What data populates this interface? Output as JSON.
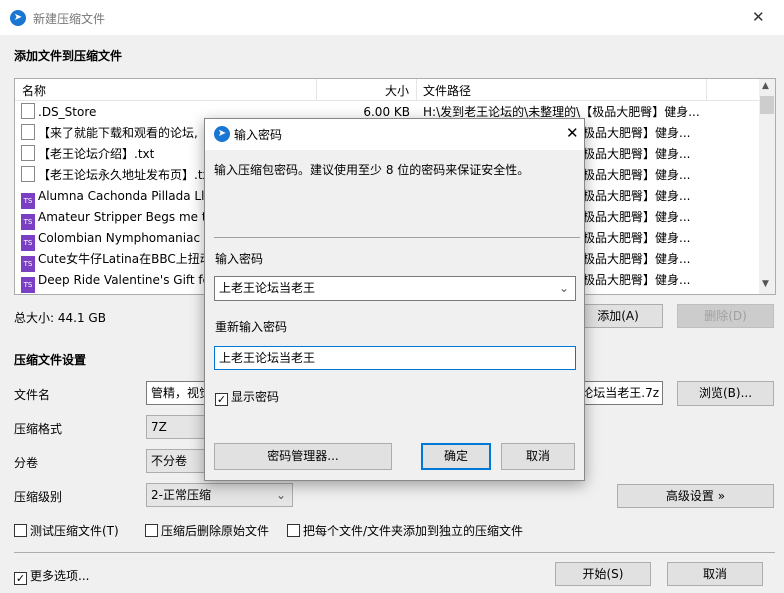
{
  "window": {
    "title": "新建压缩文件",
    "close": "✕"
  },
  "section_add": "添加文件到压缩文件",
  "list": {
    "headers": {
      "name": "名称",
      "size": "大小",
      "path": "文件路径"
    },
    "rows": [
      {
        "icon": "doc",
        "name": ".DS_Store",
        "size": "6.00 KB",
        "path": "H:\\发到老王论坛的\\未整理的\\【极品大肥臀】健身..."
      },
      {
        "icon": "doc",
        "name": "【来了就能下载和观看的论坛,",
        "size": "",
        "path": "【极品大肥臀】健身..."
      },
      {
        "icon": "doc",
        "name": "【老王论坛介绍】.txt",
        "size": "",
        "path": "【极品大肥臀】健身..."
      },
      {
        "icon": "doc",
        "name": "【老王论坛永久地址发布页】.txt",
        "size": "",
        "path": "【极品大肥臀】健身..."
      },
      {
        "icon": "ts",
        "name": "Alumna Cachonda Pillada Lle",
        "size": "",
        "path": "【极品大肥臀】健身..."
      },
      {
        "icon": "ts",
        "name": "Amateur Stripper Begs me to",
        "size": "",
        "path": "【极品大肥臀】健身..."
      },
      {
        "icon": "ts",
        "name": "Colombian Nymphomaniac i",
        "size": "",
        "path": "【极品大肥臀】健身..."
      },
      {
        "icon": "ts",
        "name": "Cute女牛仔Latina在BBC上扭动",
        "size": "",
        "path": "【极品大肥臀】健身..."
      },
      {
        "icon": "ts",
        "name": "Deep Ride Valentine's Gift fo",
        "size": "",
        "path": "【极品大肥臀】健身..."
      }
    ]
  },
  "total_size": "总大小: 44.1 GB",
  "buttons": {
    "add": "添加(A)",
    "delete": "删除(D)",
    "browse": "浏览(B)...",
    "advanced": "高级设置 »",
    "start": "开始(S)",
    "cancel": "取消"
  },
  "settings": {
    "title": "压缩文件设置",
    "filename_label": "文件名",
    "filename_value_left": "管精，视觉",
    "filename_value_right": "论坛当老王.7z",
    "format_label": "压缩格式",
    "format_value": "7Z",
    "split_label": "分卷",
    "split_value": "不分卷",
    "level_label": "压缩级别",
    "level_value": "2-正常压缩"
  },
  "checkboxes": {
    "test": {
      "label": "测试压缩文件(T)",
      "checked": false
    },
    "delete_after": {
      "label": "压缩后删除原始文件",
      "checked": false
    },
    "separate": {
      "label": "把每个文件/文件夹添加到独立的压缩文件",
      "checked": false
    },
    "more": {
      "label": "更多选项...",
      "checked": true
    }
  },
  "dialog": {
    "title": "输入密码",
    "close": "✕",
    "hint": "输入压缩包密码。建议使用至少 8 位的密码来保证安全性。",
    "pwd_label": "输入密码",
    "pwd_value": "上老王论坛当老王",
    "repwd_label": "重新输入密码",
    "repwd_value": "上老王论坛当老王",
    "show_pwd": {
      "label": "显示密码",
      "checked": true
    },
    "manager": "密码管理器...",
    "ok": "确定",
    "cancel": "取消"
  }
}
